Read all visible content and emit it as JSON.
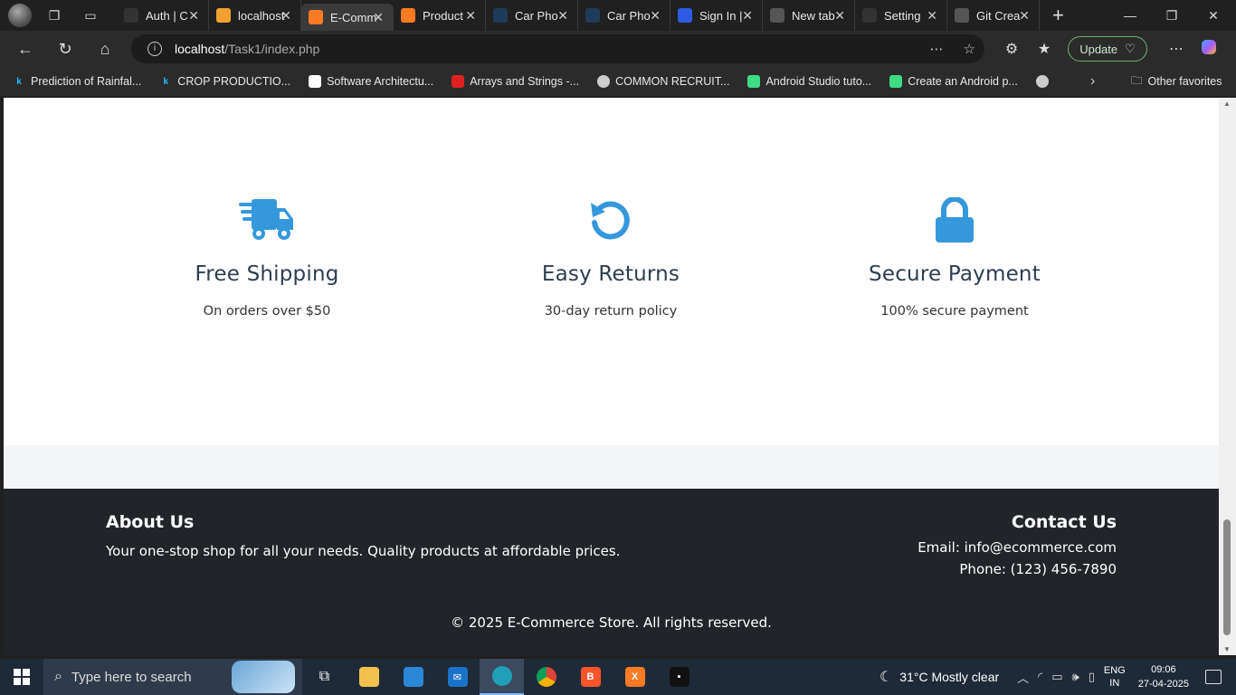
{
  "browser": {
    "tabs": [
      {
        "title": "Auth | C",
        "favicon": "github-icon",
        "color": "#333333",
        "active": false
      },
      {
        "title": "localhost",
        "favicon": "phpmyadmin-icon",
        "color": "#f0a030",
        "active": false
      },
      {
        "title": "E-Comm",
        "favicon": "xampp-icon",
        "color": "#fb7a24",
        "active": true
      },
      {
        "title": "Product",
        "favicon": "xampp-icon",
        "color": "#fb7a24",
        "active": false
      },
      {
        "title": "Car Pho",
        "favicon": "search-icon",
        "color": "#1f3b5a",
        "active": false
      },
      {
        "title": "Car Pho",
        "favicon": "search-icon",
        "color": "#1f3b5a",
        "active": false
      },
      {
        "title": "Sign In |",
        "favicon": "zoom-icon",
        "color": "#2d5be3",
        "active": false
      },
      {
        "title": "New tab",
        "favicon": "newtab-icon",
        "color": "#555555",
        "active": false
      },
      {
        "title": "Setting",
        "favicon": "github-icon",
        "color": "#333333",
        "active": false
      },
      {
        "title": "Git Crea",
        "favicon": "globe-icon",
        "color": "#555555",
        "active": false
      }
    ],
    "address": {
      "host": "localhost",
      "path": "/Task1/index.php"
    },
    "update_label": "Update",
    "bookmarks": [
      {
        "label": "Prediction of Rainfal...",
        "icon": "kaggle-icon",
        "color": "#20beff",
        "glyph": "k"
      },
      {
        "label": "CROP PRODUCTIO...",
        "icon": "kaggle-icon",
        "color": "#20beff",
        "glyph": "k"
      },
      {
        "label": "Software Architectu...",
        "icon": "page-icon",
        "color": "#ffffff",
        "glyph": ""
      },
      {
        "label": "Arrays and Strings -...",
        "icon": "bookmark-icon",
        "color": "#e02020",
        "glyph": ""
      },
      {
        "label": "COMMON RECRUIT...",
        "icon": "globe-icon",
        "color": "#cccccc",
        "glyph": ""
      },
      {
        "label": "Android Studio tuto...",
        "icon": "android-icon",
        "color": "#3ddc84",
        "glyph": ""
      },
      {
        "label": "Create an Android p...",
        "icon": "android-icon",
        "color": "#3ddc84",
        "glyph": ""
      },
      {
        "label": "",
        "icon": "globe-icon",
        "color": "#cccccc",
        "glyph": ""
      }
    ],
    "other_favorites": "Other favorites"
  },
  "page": {
    "accent": "#3498db",
    "features": [
      {
        "icon": "truck-icon",
        "title": "Free Shipping",
        "desc": "On orders over $50"
      },
      {
        "icon": "undo-icon",
        "title": "Easy Returns",
        "desc": "30-day return policy"
      },
      {
        "icon": "lock-icon",
        "title": "Secure Payment",
        "desc": "100% secure payment"
      }
    ],
    "footer": {
      "about_title": "About Us",
      "about_text": "Your one-stop shop for all your needs. Quality products at affordable prices.",
      "contact_title": "Contact Us",
      "email": "Email: info@ecommerce.com",
      "phone": "Phone: (123) 456-7890",
      "copyright": "© 2025 E-Commerce Store. All rights reserved."
    }
  },
  "taskbar": {
    "search_placeholder": "Type here to search",
    "weather": "31°C  Mostly clear",
    "lang_1": "ENG",
    "lang_2": "IN",
    "time": "09:06",
    "date": "27-04-2025"
  }
}
